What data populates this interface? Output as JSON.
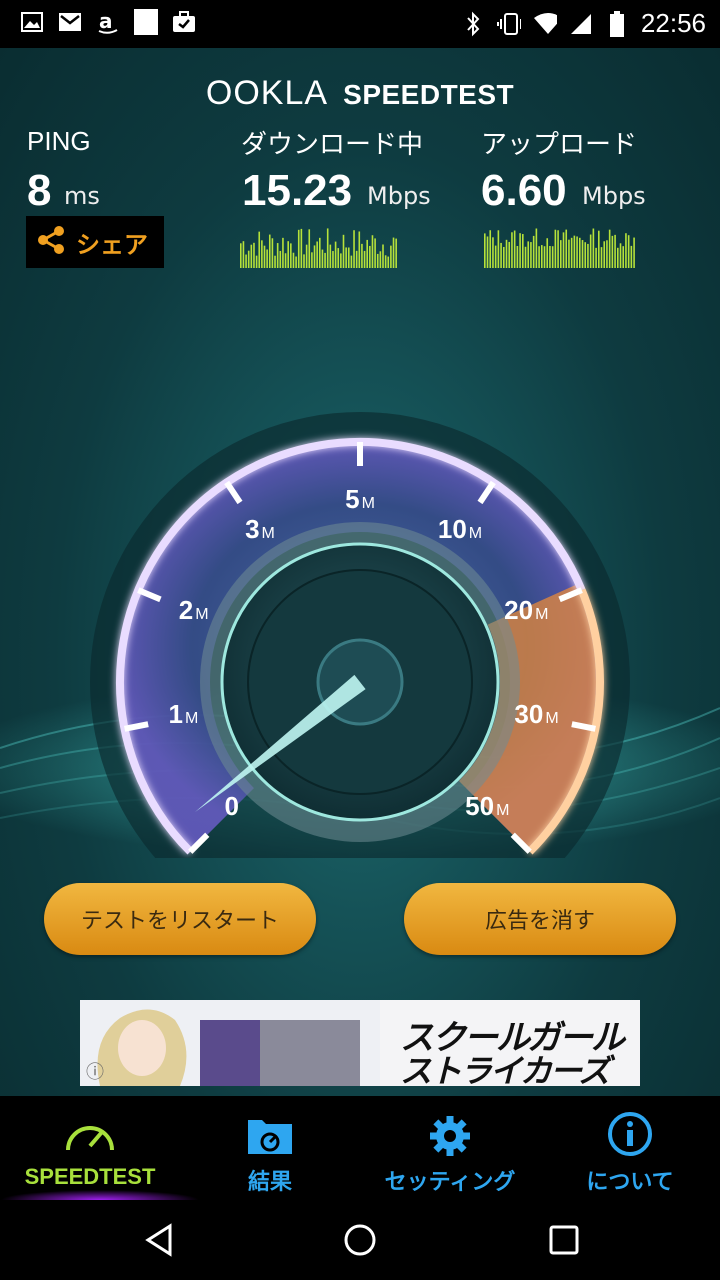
{
  "status_bar": {
    "time": "22:56",
    "left_icons": [
      "gallery-icon",
      "gmail-icon",
      "amazon-icon",
      "blank-icon",
      "briefcase-icon"
    ],
    "right_icons": [
      "bluetooth-icon",
      "vibrate-icon",
      "wifi-icon",
      "signal-icon",
      "battery-icon"
    ]
  },
  "brand": {
    "ookla": "OOKLA",
    "speedtest": "SPEEDTEST"
  },
  "ping": {
    "label": "PING",
    "value": "8",
    "unit": "ms"
  },
  "download": {
    "label": "ダウンロード中",
    "value": "15.23",
    "unit": "Mbps"
  },
  "upload": {
    "label": "アップロード",
    "value": "6.60",
    "unit": "Mbps"
  },
  "share": {
    "label": "シェア",
    "icon": "share-icon"
  },
  "gauge": {
    "ticks": [
      {
        "value": "0",
        "unit": ""
      },
      {
        "value": "1",
        "unit": "M"
      },
      {
        "value": "2",
        "unit": "M"
      },
      {
        "value": "3",
        "unit": "M"
      },
      {
        "value": "5",
        "unit": "M"
      },
      {
        "value": "10",
        "unit": "M"
      },
      {
        "value": "20",
        "unit": "M"
      },
      {
        "value": "30",
        "unit": "M"
      },
      {
        "value": "50",
        "unit": "M"
      }
    ],
    "current_mbps": 0.2,
    "accent_color": "#e8893a",
    "ring_color": "#d8b8ff"
  },
  "buttons": {
    "restart": "テストをリスタート",
    "remove_ads": "広告を消す"
  },
  "ad": {
    "line1": "スクールガール",
    "line2": "ストライカーズ",
    "small": "ⓘ"
  },
  "tabs": [
    {
      "label": "SPEEDTEST",
      "icon": "speedometer-icon",
      "color": "#a8e03c",
      "active": true
    },
    {
      "label": "結果",
      "icon": "results-folder-icon",
      "color": "#2ea6f0",
      "active": false
    },
    {
      "label": "セッティング",
      "icon": "gear-icon",
      "color": "#2ea6f0",
      "active": false
    },
    {
      "label": "について",
      "icon": "info-icon",
      "color": "#2ea6f0",
      "active": false
    }
  ],
  "navbar": {
    "icons": [
      "back-icon",
      "home-icon",
      "recents-icon"
    ]
  }
}
